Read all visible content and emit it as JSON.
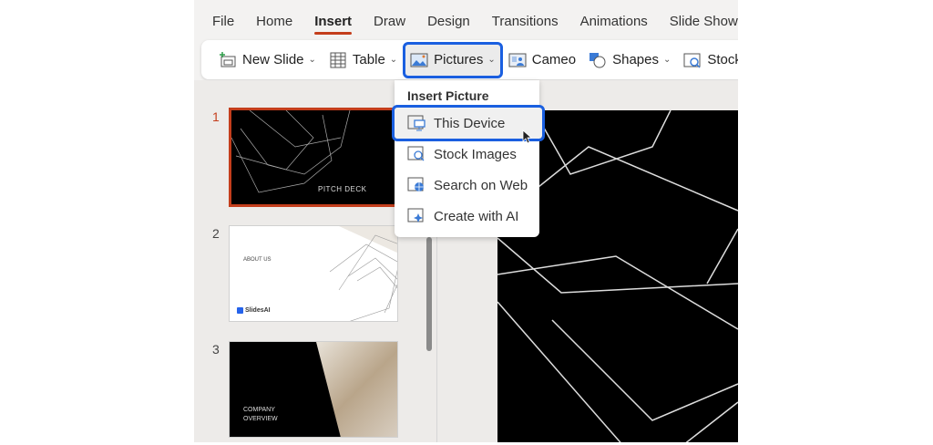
{
  "tabs": [
    "File",
    "Home",
    "Insert",
    "Draw",
    "Design",
    "Transitions",
    "Animations",
    "Slide Show"
  ],
  "active_tab": "Insert",
  "ribbon": {
    "new_slide": "New Slide",
    "table": "Table",
    "pictures": "Pictures",
    "cameo": "Cameo",
    "shapes": "Shapes",
    "stock_images": "Stock Ima"
  },
  "menu": {
    "header": "Insert Picture",
    "items": [
      "This Device",
      "Stock Images",
      "Search on Web",
      "Create with AI"
    ],
    "selected": "This Device"
  },
  "slides": [
    {
      "number": "1",
      "title": "PITCH DECK"
    },
    {
      "number": "2",
      "title": "ABOUT US",
      "logo": "SlidesAI"
    },
    {
      "number": "3",
      "title_line1": "COMPANY",
      "title_line2": "OVERVIEW"
    }
  ],
  "colors": {
    "accent": "#c43e1c",
    "highlight": "#1a5fe0"
  }
}
